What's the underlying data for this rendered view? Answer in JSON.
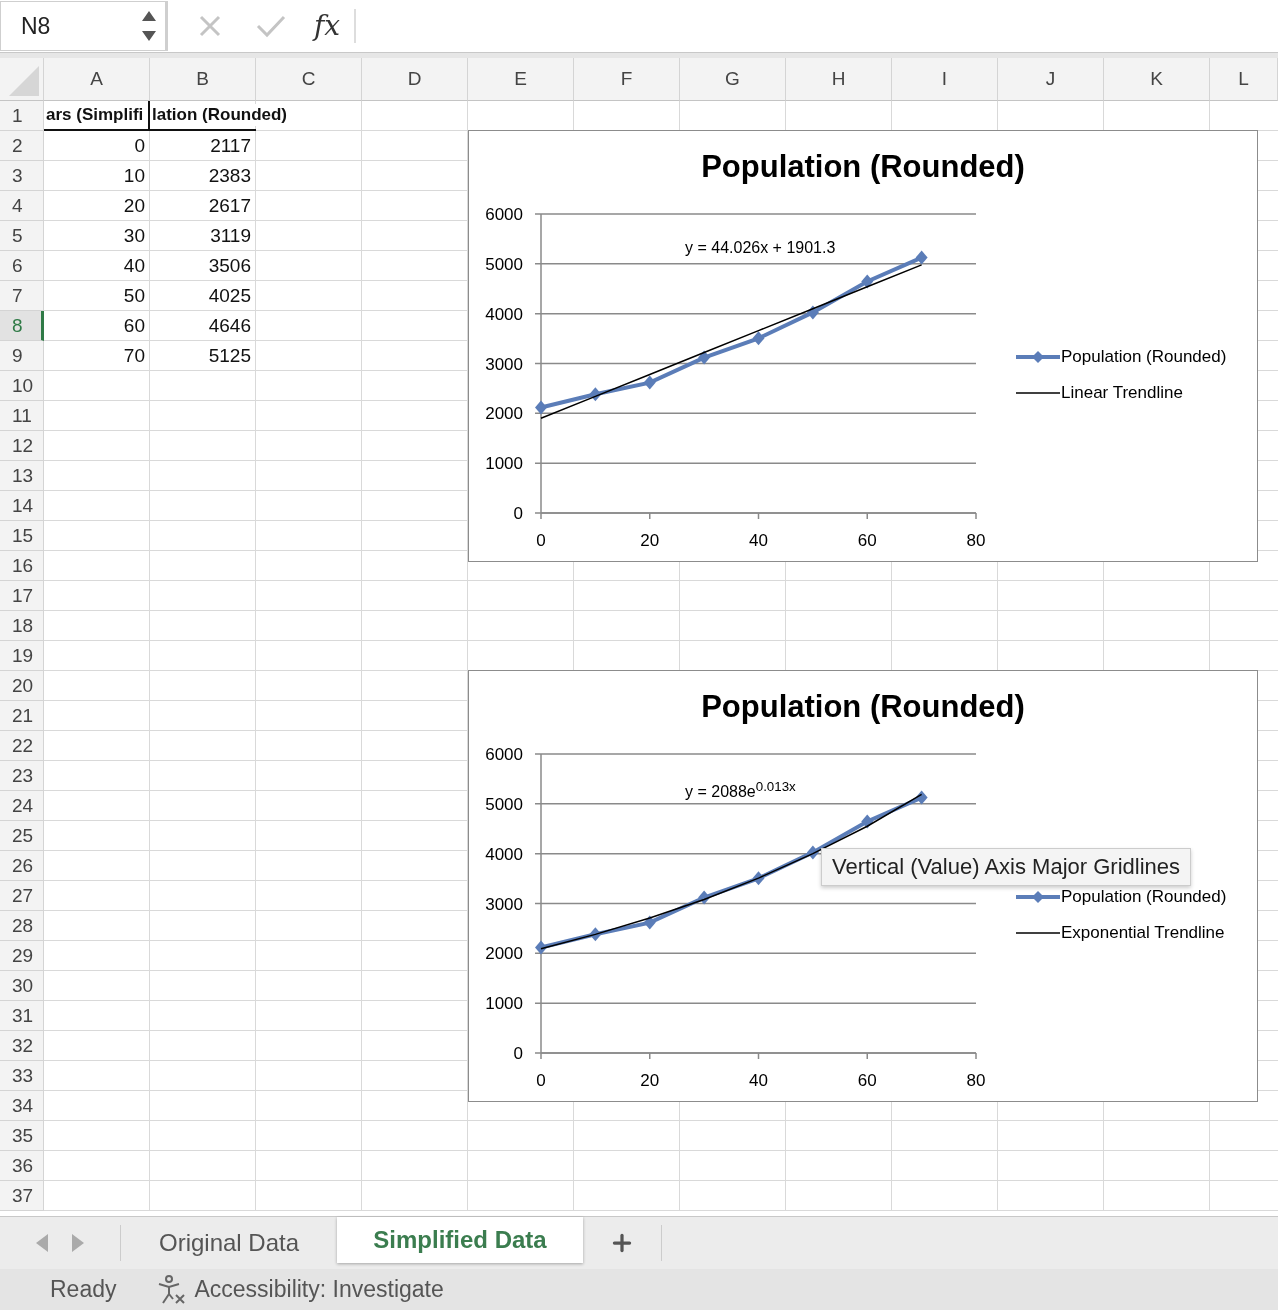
{
  "formula_bar": {
    "name_box": "N8",
    "function_label": "fx"
  },
  "columns": [
    "A",
    "B",
    "C",
    "D",
    "E",
    "F",
    "G",
    "H",
    "I",
    "J",
    "K",
    "L"
  ],
  "rows": [
    {
      "number": "1",
      "selected": false,
      "kind": "header",
      "cells": [
        "ars (Simplifi",
        "lation (Rounded)"
      ]
    },
    {
      "number": "2",
      "selected": false,
      "kind": "data",
      "cells": [
        "0",
        "2117"
      ]
    },
    {
      "number": "3",
      "selected": false,
      "kind": "data",
      "cells": [
        "10",
        "2383"
      ]
    },
    {
      "number": "4",
      "selected": false,
      "kind": "data",
      "cells": [
        "20",
        "2617"
      ]
    },
    {
      "number": "5",
      "selected": false,
      "kind": "data",
      "cells": [
        "30",
        "3119"
      ]
    },
    {
      "number": "6",
      "selected": false,
      "kind": "data",
      "cells": [
        "40",
        "3506"
      ]
    },
    {
      "number": "7",
      "selected": false,
      "kind": "data",
      "cells": [
        "50",
        "4025"
      ]
    },
    {
      "number": "8",
      "selected": true,
      "kind": "data",
      "cells": [
        "60",
        "4646"
      ]
    },
    {
      "number": "9",
      "selected": false,
      "kind": "data",
      "cells": [
        "70",
        "5125"
      ]
    },
    {
      "number": "10",
      "selected": false
    },
    {
      "number": "11",
      "selected": false
    },
    {
      "number": "12",
      "selected": false
    },
    {
      "number": "13",
      "selected": false
    },
    {
      "number": "14",
      "selected": false
    },
    {
      "number": "15",
      "selected": false
    },
    {
      "number": "16",
      "selected": false
    },
    {
      "number": "17",
      "selected": false
    },
    {
      "number": "18",
      "selected": false
    },
    {
      "number": "19",
      "selected": false
    },
    {
      "number": "20",
      "selected": false
    },
    {
      "number": "21",
      "selected": false
    },
    {
      "number": "22",
      "selected": false
    },
    {
      "number": "23",
      "selected": false
    },
    {
      "number": "24",
      "selected": false
    },
    {
      "number": "25",
      "selected": false
    },
    {
      "number": "26",
      "selected": false
    },
    {
      "number": "27",
      "selected": false
    },
    {
      "number": "28",
      "selected": false
    },
    {
      "number": "29",
      "selected": false
    },
    {
      "number": "30",
      "selected": false
    },
    {
      "number": "31",
      "selected": false
    },
    {
      "number": "32",
      "selected": false
    },
    {
      "number": "33",
      "selected": false
    },
    {
      "number": "34",
      "selected": false
    },
    {
      "number": "35",
      "selected": false
    },
    {
      "number": "36",
      "selected": false
    },
    {
      "number": "37",
      "selected": false
    }
  ],
  "charts": [
    {
      "trendline_label": "y = 44.026x + 1901.3",
      "chart_data": {
        "type": "line",
        "title": "Population (Rounded)",
        "x": [
          0,
          10,
          20,
          30,
          40,
          50,
          60,
          70
        ],
        "series": [
          {
            "name": "Population (Rounded)",
            "color": "#5b7db8",
            "marker": "diamond",
            "values": [
              2117,
              2383,
              2617,
              3119,
              3506,
              4025,
              4646,
              5125
            ]
          },
          {
            "name": "Linear Trendline",
            "color": "#000000",
            "values": [
              1900,
              2340,
              2780,
              3220,
              3660,
              4100,
              4540,
              4980
            ]
          }
        ],
        "xlim": [
          0,
          80
        ],
        "ylim": [
          0,
          6000
        ],
        "xticks": [
          0,
          20,
          40,
          60,
          80
        ],
        "yticks": [
          0,
          1000,
          2000,
          3000,
          4000,
          5000,
          6000
        ],
        "grid": "y",
        "legend": true
      }
    },
    {
      "trendline_label": "y = 2088e$^{0.013x}$",
      "tooltip": "Vertical (Value) Axis Major Gridlines",
      "chart_data": {
        "type": "line",
        "title": "Population (Rounded)",
        "x": [
          0,
          10,
          20,
          30,
          40,
          50,
          60,
          70
        ],
        "series": [
          {
            "name": "Population (Rounded)",
            "color": "#5b7db8",
            "marker": "diamond",
            "values": [
              2117,
              2383,
              2617,
              3119,
              3506,
              4025,
              4646,
              5125
            ]
          },
          {
            "name": "Exponential Trendline",
            "color": "#000000",
            "values": [
              2090,
              2380,
              2710,
              3080,
              3510,
              4000,
              4550,
              5190
            ]
          }
        ],
        "xlim": [
          0,
          80
        ],
        "ylim": [
          0,
          6000
        ],
        "xticks": [
          0,
          20,
          40,
          60,
          80
        ],
        "yticks": [
          0,
          1000,
          2000,
          3000,
          4000,
          5000,
          6000
        ],
        "grid": "y",
        "legend": true
      }
    }
  ],
  "sheet_tabs": [
    {
      "label": "Original Data",
      "selected": false
    },
    {
      "label": "Simplified Data",
      "selected": true
    }
  ],
  "status_bar": {
    "mode": "Ready",
    "accessibility": "Accessibility: Investigate"
  }
}
